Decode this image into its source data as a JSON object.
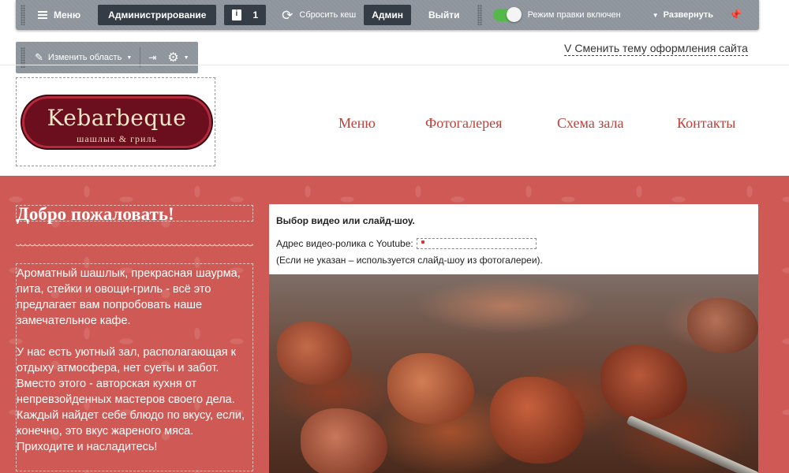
{
  "admin_bar": {
    "menu_label": "Меню",
    "admin_label": "Администрирование",
    "notifications_count": "1",
    "reset_cache_label": "Сбросить кеш",
    "user_label": "Админ",
    "logout_label": "Выйти",
    "edit_mode_label": "Режим правки включен",
    "edit_mode_on": true,
    "expand_label": "Развернуть"
  },
  "area_toolbar": {
    "change_area_label": "Изменить область"
  },
  "theme_link": {
    "prefix": "V",
    "label": "Сменить тему оформления сайта"
  },
  "logo": {
    "title": "Kebarbeque",
    "subtitle": "шашлык & гриль"
  },
  "nav": {
    "items": [
      "Меню",
      "Фотогалерея",
      "Схема зала",
      "Контакты"
    ]
  },
  "content": {
    "welcome_title": "Добро пожаловать!",
    "paragraph_1": "Ароматный шашлык, прекрасная шаурма, пита, стейки и овощи-гриль - всё это предлагает вам попробовать наше замечательное кафе.",
    "paragraph_2": "У нас есть уютный зал, располагающая к отдыху атмосфера, нет суеты и забот. Вместо этого - авторская кухня от непревзойденных мастеров своего дела. Каждый найдет себе блюдо по вкусу, если, конечно, это вкус жареного мяса. Приходите и насладитесь!"
  },
  "video_panel": {
    "title": "Выбор видео или слайд-шоу.",
    "address_label": "Адрес видео-ролика с Youtube:",
    "address_value": "",
    "note": "(Если не указан – используется слайд-шоу из фотогалереи)."
  },
  "colors": {
    "admin_bar": "#8e949c",
    "admin_dark": "#343c46",
    "toggle_on": "#55b94a",
    "nav_link": "#c0413a",
    "band": "#cf5a55",
    "logo_bg": "#6b0f1e"
  }
}
